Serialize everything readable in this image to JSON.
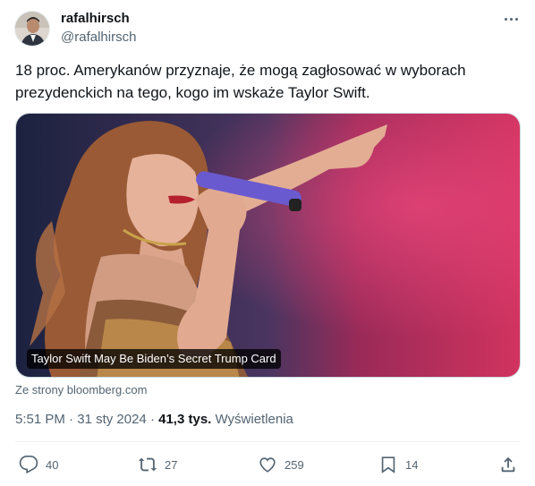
{
  "author": {
    "name": "rafalhirsch",
    "handle": "@rafalhirsch"
  },
  "tweet": {
    "text": "18 proc. Amerykanów przyznaje, że mogą zagłosować w wyborach\nprezydenckich na tego, kogo im wskaże Taylor Swift."
  },
  "card": {
    "caption": "Taylor Swift May Be Biden’s Secret Trump Card",
    "source": "Ze strony bloomberg.com"
  },
  "meta": {
    "time": "5:51 PM",
    "sep1": " · ",
    "date": "31 sty 2024",
    "sep2": " · ",
    "views_count": "41,3 tys.",
    "views_label": " Wyświetlenia"
  },
  "actions": {
    "reply_count": "40",
    "retweet_count": "27",
    "like_count": "259",
    "bookmark_count": "14"
  },
  "icons": {
    "more": "more-horizontal-icon",
    "reply": "reply-icon",
    "retweet": "retweet-icon",
    "like": "heart-icon",
    "bookmark": "bookmark-icon",
    "share": "share-icon"
  }
}
